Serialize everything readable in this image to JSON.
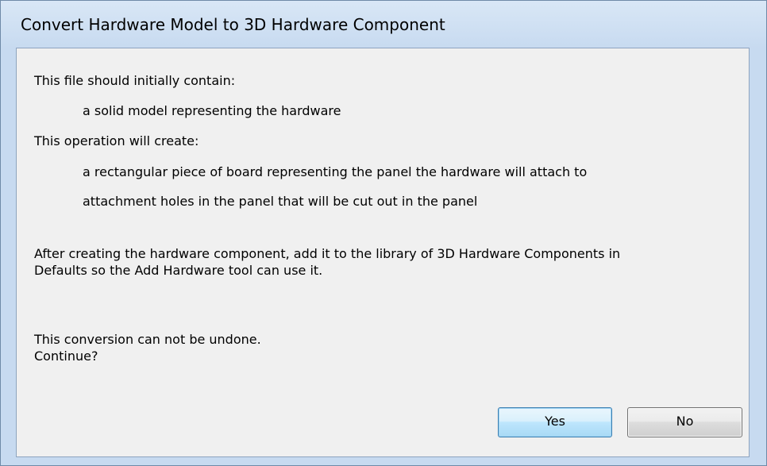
{
  "dialog": {
    "title": "Convert Hardware Model to 3D Hardware Component",
    "message": {
      "line1": "This file should initially contain:",
      "line2": "a solid model representing the hardware",
      "line3": "This operation will create:",
      "line4": "a rectangular piece of board representing the panel the hardware will attach to",
      "line5": "attachment holes in the panel that will be cut out in the panel",
      "line6": "After creating the hardware component, add it to the library of 3D Hardware Components in",
      "line7": "Defaults so the Add Hardware tool can use it.",
      "line8": "This conversion can not be undone.",
      "line9": "Continue?"
    },
    "buttons": {
      "yes_label": "Yes",
      "no_label": "No"
    }
  }
}
